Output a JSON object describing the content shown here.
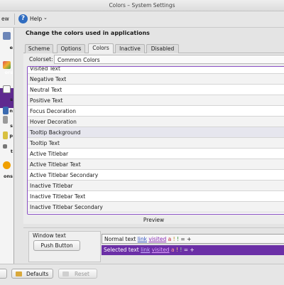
{
  "window": {
    "title": "Colors – System Settings"
  },
  "toolbar": {
    "overview_label": "ew",
    "help_label": "Help",
    "help_icon": "help-icon"
  },
  "sidebar": {
    "items": [
      {
        "label": "e",
        "icon": "appearance-icon"
      },
      {
        "label": "ors",
        "icon": "colors-icon",
        "active": true
      },
      {
        "label": "s",
        "icon": "fonts-icon"
      },
      {
        "label": "n",
        "icon": "icons-icon"
      },
      {
        "label": "s",
        "icon": "styles-icon"
      },
      {
        "label": "p",
        "icon": "emoticons-icon"
      },
      {
        "label": "t",
        "icon": "splash-icon"
      },
      {
        "label": "ons",
        "icon": "notifications-icon"
      }
    ]
  },
  "page": {
    "heading": "Change the colors used in applications",
    "tabs": [
      "Scheme",
      "Options",
      "Colors",
      "Inactive",
      "Disabled"
    ],
    "active_tab": "Colors",
    "colorset_label": "Colorset:",
    "colorset_value": "Common Colors",
    "color_roles": [
      "Visited Text",
      "Negative Text",
      "Neutral Text",
      "Positive Text",
      "Focus Decoration",
      "Hover Decoration",
      "Tooltip Background",
      "Tooltip Text",
      "Active Titlebar",
      "Active Titlebar Text",
      "Active Titlebar Secondary",
      "Inactive Titlebar",
      "Inactive Titlebar Text",
      "Inactive Titlebar Secondary"
    ],
    "selected_role": "Tooltip Background"
  },
  "preview": {
    "title": "Preview",
    "window_text": "Window text",
    "push_button": "Push Button",
    "normal_text": "Normal text",
    "selected_text": "Selected text",
    "link": "link",
    "visited": "visited",
    "neg": "a",
    "neu": "!",
    "pos": "!",
    "tail": "= +"
  },
  "buttons": {
    "help_partial": "",
    "defaults": "Defaults",
    "reset": "Reset"
  },
  "colors": {
    "accent": "#8a4fc4",
    "selection": "#6b2fa6",
    "link": "#2a4fc0",
    "visited": "#8a2ab5"
  }
}
